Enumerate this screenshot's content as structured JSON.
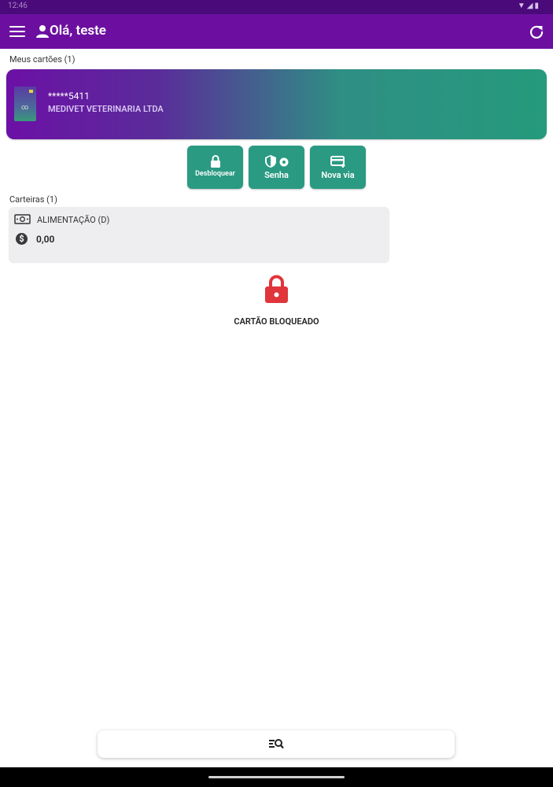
{
  "status_bar": {
    "time": "12:46"
  },
  "header": {
    "greeting": "Olá, teste"
  },
  "cards_section": {
    "label": "Meus cartões (1)"
  },
  "card": {
    "number": "*****5411",
    "company": "MEDIVET VETERINARIA LTDA"
  },
  "actions": [
    {
      "label": "Desbloquear",
      "icon": "lock-icon"
    },
    {
      "label": "Senha",
      "icon": "shield-key-icon"
    },
    {
      "label": "Nova via",
      "icon": "card-plus-icon"
    }
  ],
  "wallets_section": {
    "label": "Carteiras (1)"
  },
  "wallet": {
    "name": "ALIMENTAÇÃO (D)",
    "balance": "0,00"
  },
  "blocked": {
    "message": "CARTÃO BLOQUEADO"
  },
  "colors": {
    "appbar": "#6c0fa0",
    "accent": "#2a9a82",
    "danger": "#e0353b"
  }
}
